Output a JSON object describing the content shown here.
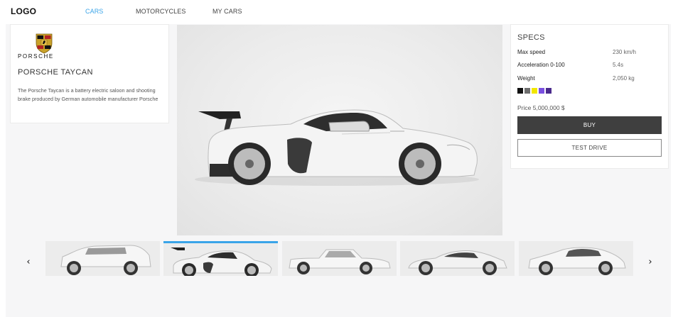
{
  "header": {
    "logo": "LOGO",
    "nav": [
      {
        "label": "CARS",
        "active": true
      },
      {
        "label": "MOTORCYCLES",
        "active": false
      },
      {
        "label": "MY CARS",
        "active": false
      }
    ]
  },
  "brand": {
    "wordmark": "PORSCHE",
    "crest_icon": "porsche-crest-icon"
  },
  "car": {
    "title": "PORSCHE TAYCAN",
    "description": "The Porsche Taycan is a battery electric saloon and shooting brake produced by German automobile manufacturer Porsche"
  },
  "specs": {
    "title": "SPECS",
    "rows": [
      {
        "label": "Max speed",
        "value": "230 km/h"
      },
      {
        "label": "Acceleration 0-100",
        "value": "5.4s"
      },
      {
        "label": "Weight",
        "value": "2,050 kg"
      }
    ],
    "colors": [
      "#111111",
      "#6e6e6e",
      "#f2e600",
      "#7a4fe0",
      "#4a2a8c"
    ],
    "price": "Price 5,000,000 $",
    "buy_label": "BUY",
    "test_drive_label": "TEST DRIVE"
  },
  "carousel": {
    "prev_icon": "chevron-left-icon",
    "next_icon": "chevron-right-icon",
    "prev_glyph": "‹",
    "next_glyph": "›",
    "thumbnails": [
      {
        "name": "suv",
        "active": false
      },
      {
        "name": "race-car",
        "active": true
      },
      {
        "name": "classic-sedan",
        "active": false
      },
      {
        "name": "sports-coupe",
        "active": false
      },
      {
        "name": "crossover",
        "active": false
      }
    ]
  }
}
